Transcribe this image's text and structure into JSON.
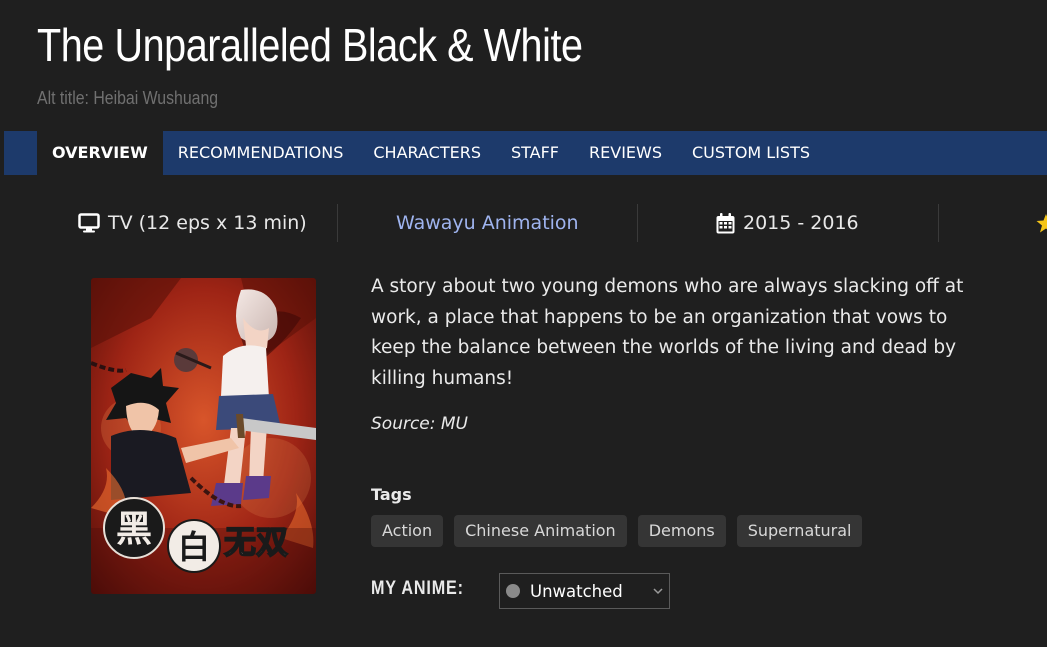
{
  "title": "The Unparalleled Black & White",
  "alt_title": "Alt title: Heibai Wushuang",
  "tabs": [
    {
      "label": "OVERVIEW",
      "active": true
    },
    {
      "label": "RECOMMENDATIONS"
    },
    {
      "label": "CHARACTERS"
    },
    {
      "label": "STAFF"
    },
    {
      "label": "REVIEWS"
    },
    {
      "label": "CUSTOM LISTS"
    }
  ],
  "meta": {
    "type": "TV (12 eps x 13 min)",
    "type_icon": "tv-icon",
    "studio": "Wawayu Animation",
    "years": "2015 - 2016",
    "years_icon": "calendar-icon",
    "rating_icon": "star-icon"
  },
  "poster": {
    "logo_text": "黑白无双"
  },
  "synopsis": "A story about two young demons who are always slacking off at work, a place that happens to be an organization that vows to keep the balance between the worlds of the living and dead by killing humans!",
  "source": "Source: MU",
  "tags_label": "Tags",
  "tags": [
    "Action",
    "Chinese Animation",
    "Demons",
    "Supernatural"
  ],
  "my_anime": {
    "label": "MY ANIME:",
    "status": "Unwatched"
  },
  "colors": {
    "background": "#1f1f1f",
    "tab_bar": "#1d3a6b",
    "studio_link": "#9fb4ef",
    "tag_bg": "#353535",
    "star": "#f5c518"
  }
}
